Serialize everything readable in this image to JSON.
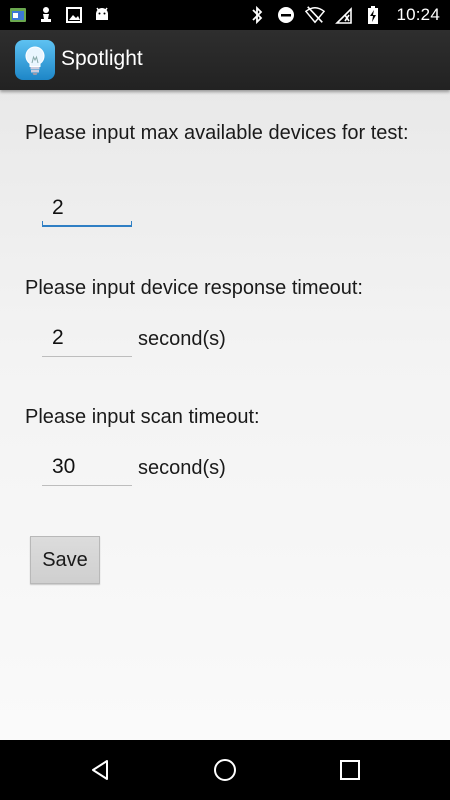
{
  "status_bar": {
    "time": "10:24",
    "left_icons": [
      "app-notification-icon",
      "chess-pawn-icon",
      "image-icon",
      "android-icon"
    ],
    "right_icons": [
      "bluetooth-icon",
      "do-not-disturb-icon",
      "wifi-off-icon",
      "signal-icon",
      "battery-charging-icon"
    ]
  },
  "action_bar": {
    "title": "Spotlight",
    "icon": "lightbulb-icon"
  },
  "form": {
    "max_devices": {
      "label": "Please input max available devices for test:",
      "value": "2"
    },
    "response_timeout": {
      "label": "Please input device response timeout:",
      "value": "2",
      "unit": "second(s)"
    },
    "scan_timeout": {
      "label": "Please input scan timeout:",
      "value": "30",
      "unit": "second(s)"
    },
    "save_label": "Save"
  },
  "nav_bar": {
    "back": "back-icon",
    "home": "home-icon",
    "recents": "recents-icon"
  },
  "colors": {
    "accent": "#2f7fc4",
    "action_bar": "#282828",
    "background": "#f2f2f2"
  }
}
